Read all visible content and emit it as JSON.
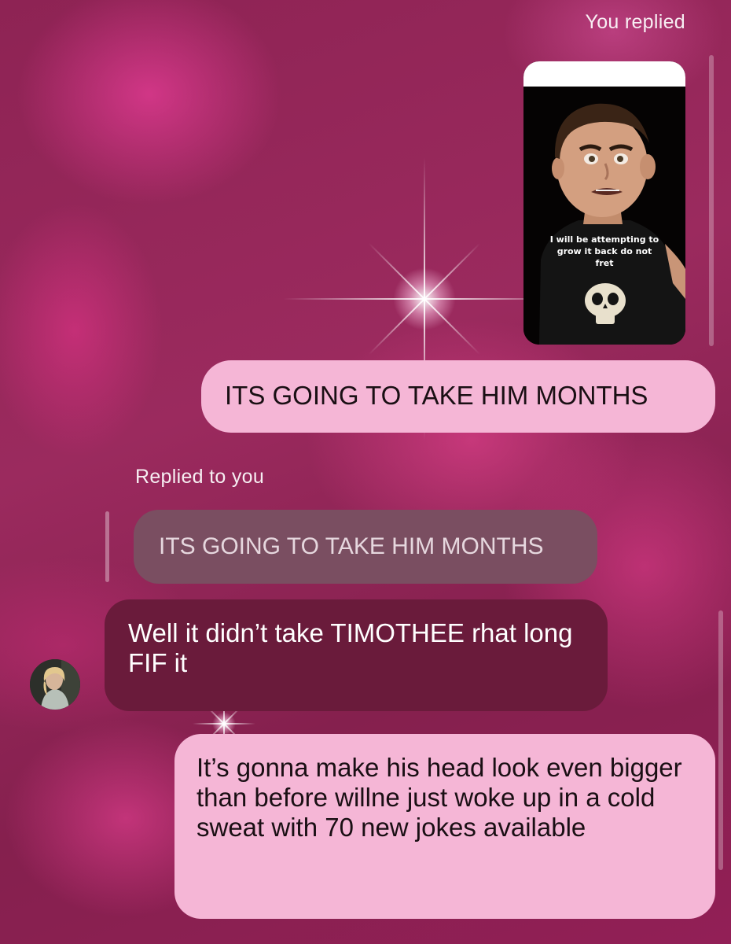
{
  "thread": {
    "you_replied_label": "You replied",
    "replied_to_you_label": "Replied to you",
    "story_caption": "I will be attempting to grow it back do not fret",
    "messages": [
      {
        "text": "ITS GOING TO TAKE HIM MONTHS"
      },
      {
        "text": "ITS GOING TO TAKE HIM MONTHS"
      },
      {
        "text": "Well it didn’t take TIMOTHEE rhat long FIF it"
      },
      {
        "text": "It’s gonna make his head look even bigger than before willne just woke up in a cold sweat with 70 new jokes available"
      }
    ]
  },
  "colors": {
    "outgoing_bubble": "#f5b6d6",
    "incoming_bubble": "#6a1b3b",
    "quoted_bubble": "#7a4e61",
    "background": "#8e2354"
  },
  "icons": {
    "sparkle": "sparkle-decoration",
    "story_thumbnail": "cartoon-boy-skull-shirt"
  }
}
